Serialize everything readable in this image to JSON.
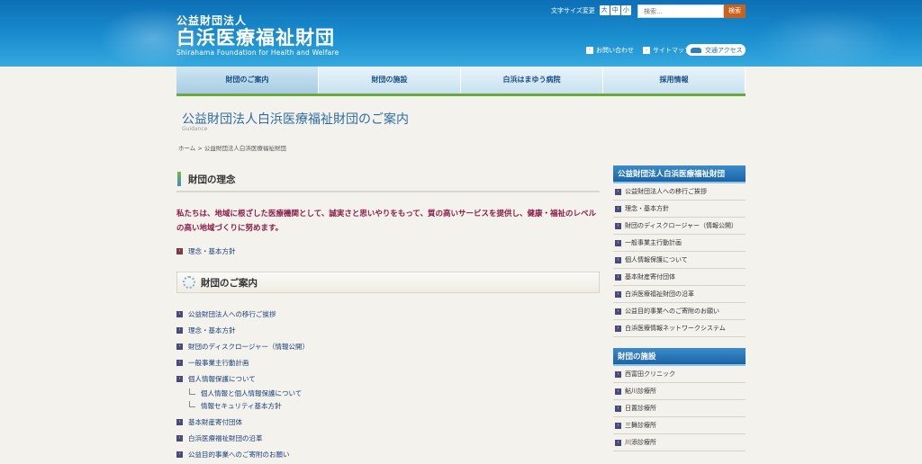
{
  "header": {
    "org_type": "公益財団法人",
    "org_name": "白浜医療福祉財団",
    "org_name_en": "Shirahama Foundation for Health and Welfare",
    "font_size_label": "文字サイズ変更",
    "font_sizes": [
      "大",
      "中",
      "小"
    ],
    "search_placeholder": "検索…",
    "search_button": "検索",
    "contact": "お問い合わせ",
    "sitemap": "サイトマップ",
    "access": "交通アクセス"
  },
  "nav": [
    {
      "label": "財団のご案内"
    },
    {
      "label": "財団の施設"
    },
    {
      "label": "白浜はまゆう病院"
    },
    {
      "label": "採用情報"
    }
  ],
  "page": {
    "title": "公益財団法人白浜医療福祉財団のご案内",
    "subtitle": "Guidance",
    "breadcrumb": "ホーム > 公益財団法人白浜医療福祉財団"
  },
  "main": {
    "philosophy_heading": "財団の理念",
    "mission": "私たちは、地域に根ざした医療機関として、誠実さと思いやりをもって、質の高いサービスを提供し、健康・福祉のレベルの高い地域づくりに努めます。",
    "philosophy_link": "理念・基本方針",
    "guide_heading": "財団のご案内",
    "links": [
      {
        "label": "公益財団法人への移行ご挨拶"
      },
      {
        "label": "理念・基本方針"
      },
      {
        "label": "財団のディスクロージャー（情報公開）"
      },
      {
        "label": "一般事業主行動計画"
      },
      {
        "label": "個人情報保護について"
      }
    ],
    "sublinks": [
      {
        "label": "個人情報と個人情報保護について"
      },
      {
        "label": "情報セキュリティ基本方針"
      }
    ],
    "links2": [
      {
        "label": "基本財産寄付団体"
      },
      {
        "label": "白浜医療福祉財団の沿革"
      },
      {
        "label": "公益目的事業へのご寄附のお願い"
      }
    ]
  },
  "sidebar": {
    "section1_title": "公益財団法人白浜医療福祉財団",
    "section1_items": [
      {
        "label": "公益財団法人への移行ご挨拶"
      },
      {
        "label": "理念・基本方針"
      },
      {
        "label": "財団のディスクロージャー（情報公開）"
      },
      {
        "label": "一般事業主行動計画"
      },
      {
        "label": "個人情報保護について"
      },
      {
        "label": "基本財産寄付団体"
      },
      {
        "label": "白浜医療福祉財団の沿革"
      },
      {
        "label": "公益目的事業へのご寄附のお願い"
      },
      {
        "label": "白浜医療情報ネットワークシステム"
      }
    ],
    "section2_title": "財団の施設",
    "section2_items": [
      {
        "label": "西富田クリニック"
      },
      {
        "label": "鮎川診療所"
      },
      {
        "label": "日置診療所"
      },
      {
        "label": "三舞診療所"
      },
      {
        "label": "川添診療所"
      }
    ]
  },
  "colors": {
    "header_blue": "#1a8ed0",
    "nav_accent_green": "#6aaa3c",
    "mission_text": "#8a1c4a",
    "sidebar_heading": "#1c63a6",
    "search_button": "#c8621f"
  }
}
